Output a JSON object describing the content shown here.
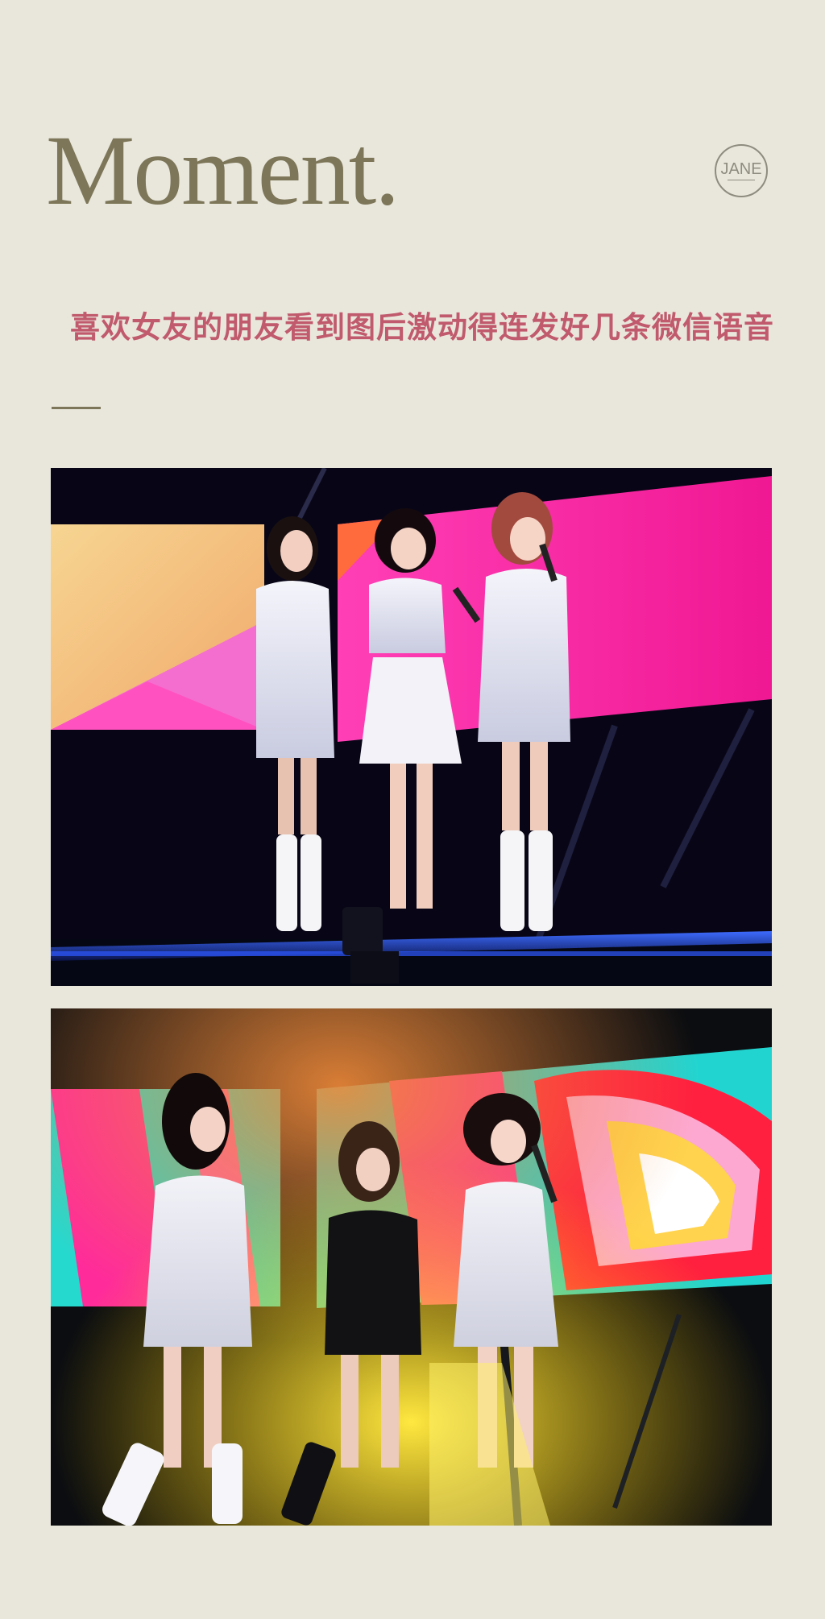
{
  "header": {
    "title": "Moment.",
    "logo_text": "JANE"
  },
  "article": {
    "subtitle": "喜欢女友的朋友看到图后激动得连发好几条微信语音"
  },
  "photos": [
    {
      "name": "concert-photo-1"
    },
    {
      "name": "concert-photo-2"
    }
  ],
  "colors": {
    "background": "#e9e7dc",
    "title": "#7d7659",
    "subtitle": "#c05a6c",
    "badge": "#8e8b7f"
  }
}
